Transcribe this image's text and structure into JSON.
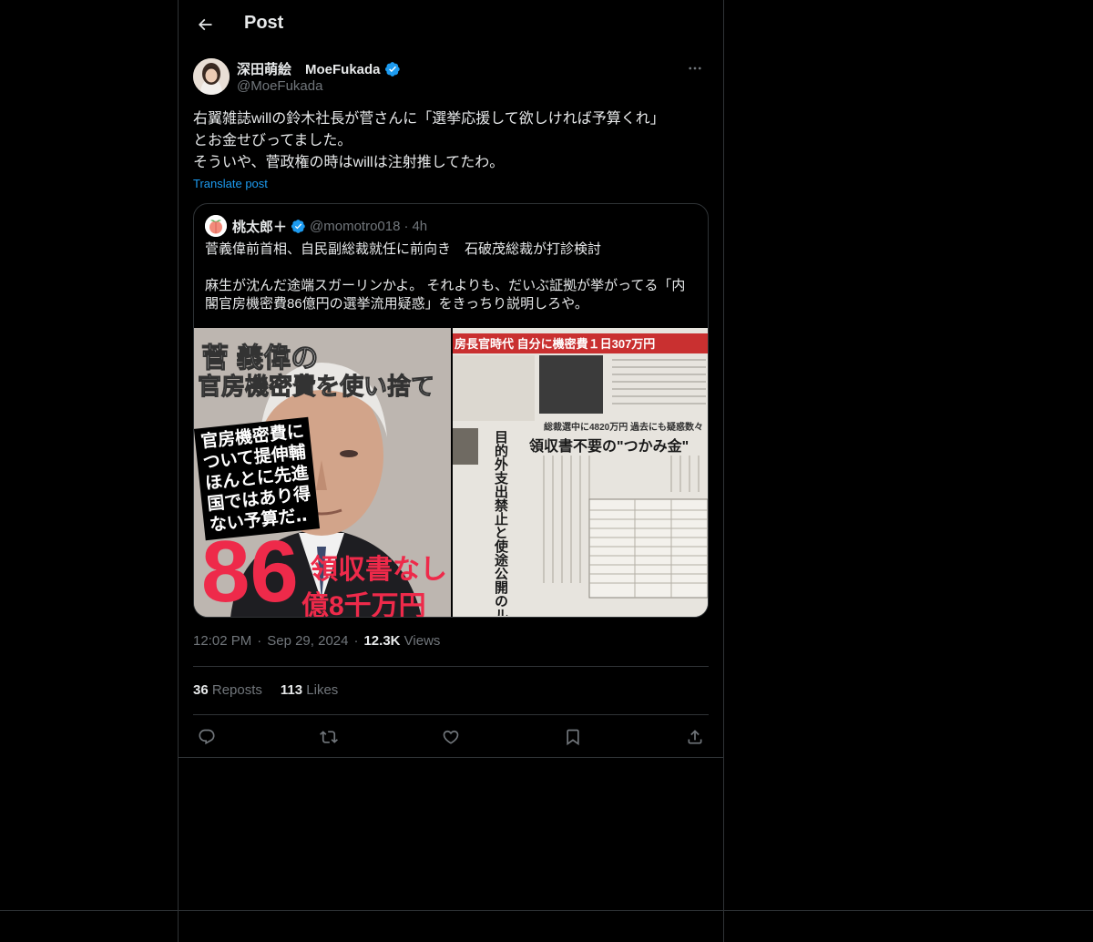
{
  "header": {
    "title": "Post"
  },
  "author": {
    "display_name": "深田萌絵　MoeFukada",
    "handle": "@MoeFukada",
    "verified": true
  },
  "post": {
    "lines": [
      "右翼雑誌willの鈴木社長が菅さんに「選挙応援して欲しければ予算くれ」",
      "とお金せびってました。",
      "そういや、菅政権の時はwillは注射推してたわ。"
    ],
    "translate_label": "Translate post"
  },
  "quote": {
    "display_name": "桃太郎＋",
    "handle": "@momotro018",
    "separator": "·",
    "time": "4h",
    "lines": [
      "菅義偉前首相、自民副総裁就任に前向き　石破茂総裁が打診検討",
      "",
      "麻生が沈んだ途端スガーリンかよ。 それよりも、だいぶ証拠が挙がってる「内",
      "閣官房機密費86億円の選挙流用疑惑」をきっちり説明しろや。"
    ],
    "image_left": {
      "title_line1": "菅 義偉の",
      "title_line2": "官房機密費を使い捨て",
      "caption": "官房機密費に\nついて提伸輔\nほんとに先進\n国ではあり得\nない予算だ‥",
      "big_number": "86",
      "amount_line1": "領収書なし",
      "amount_line2": "億8千万円"
    },
    "image_right": {
      "headline": "房長官時代 自分に機密費１日307万円",
      "subhead": "総裁選中に4820万円 過去にも疑惑数々",
      "big_headline": "領収書不要の\"つかみ金\"",
      "vertical": "目的外支出禁止と使途公開のルール不可"
    }
  },
  "meta": {
    "time": "12:02 PM",
    "sep1": "·",
    "date": "Sep 29, 2024",
    "sep2": "·",
    "views_count": "12.3K",
    "views_label": "Views"
  },
  "stats": {
    "reposts_count": "36",
    "reposts_label": "Reposts",
    "likes_count": "113",
    "likes_label": "Likes"
  },
  "icons": [
    "back-arrow-icon",
    "verified-badge-icon",
    "more-icon",
    "reply-icon",
    "repost-icon",
    "like-icon",
    "bookmark-icon",
    "share-icon"
  ],
  "colors": {
    "background": "#000000",
    "text": "#e7e9ea",
    "muted": "#71767b",
    "accent": "#1d9bf0",
    "border": "#2f3336"
  }
}
